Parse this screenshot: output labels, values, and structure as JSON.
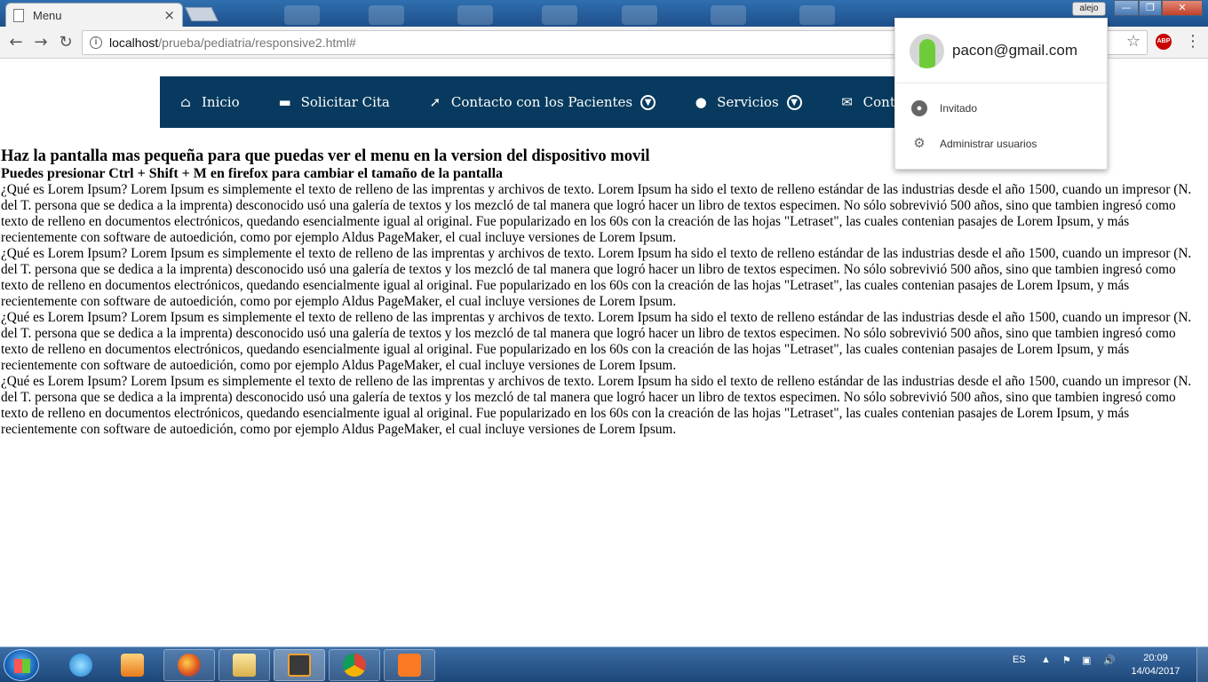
{
  "browser": {
    "tab_title": "Menu",
    "tab_close": "×",
    "user_badge": "alejo",
    "url_host": "localhost",
    "url_path": "/prueba/pediatria/responsive2.html#",
    "controls": {
      "back_icon": "arrow-left-icon",
      "forward_icon": "arrow-right-icon",
      "reload_icon": "reload-icon"
    },
    "extension_label": "ABP"
  },
  "nav": {
    "items": [
      {
        "label": "Inicio",
        "icon": "home-icon"
      },
      {
        "label": "Solicitar Cita",
        "icon": "briefcase-icon"
      },
      {
        "label": "Contacto con los Pacientes",
        "icon": "rocket-icon",
        "dropdown": true
      },
      {
        "label": "Servicios",
        "icon": "globe-icon",
        "dropdown": true
      },
      {
        "label": "Contacto",
        "icon": "envelope-icon"
      }
    ],
    "color": "#073a5e"
  },
  "content": {
    "heading": "Haz la pantalla mas pequeña para que puedas ver el menu en la version del dispositivo movil",
    "subheading": "Puedes presionar Ctrl + Shift + M en firefox para cambiar el tamaño de la pantalla",
    "paragraphs": [
      "¿Qué es Lorem Ipsum? Lorem Ipsum es simplemente el texto de relleno de las imprentas y archivos de texto. Lorem Ipsum ha sido el texto de relleno estándar de las industrias desde el año 1500, cuando un impresor (N. del T. persona que se dedica a la imprenta) desconocido usó una galería de textos y los mezcló de tal manera que logró hacer un libro de textos especimen. No sólo sobrevivió 500 años, sino que tambien ingresó como texto de relleno en documentos electrónicos, quedando esencialmente igual al original. Fue popularizado en los 60s con la creación de las hojas \"Letraset\", las cuales contenian pasajes de Lorem Ipsum, y más recientemente con software de autoedición, como por ejemplo Aldus PageMaker, el cual incluye versiones de Lorem Ipsum.",
      "¿Qué es Lorem Ipsum? Lorem Ipsum es simplemente el texto de relleno de las imprentas y archivos de texto. Lorem Ipsum ha sido el texto de relleno estándar de las industrias desde el año 1500, cuando un impresor (N. del T. persona que se dedica a la imprenta) desconocido usó una galería de textos y los mezcló de tal manera que logró hacer un libro de textos especimen. No sólo sobrevivió 500 años, sino que tambien ingresó como texto de relleno en documentos electrónicos, quedando esencialmente igual al original. Fue popularizado en los 60s con la creación de las hojas \"Letraset\", las cuales contenian pasajes de Lorem Ipsum, y más recientemente con software de autoedición, como por ejemplo Aldus PageMaker, el cual incluye versiones de Lorem Ipsum.",
      "¿Qué es Lorem Ipsum? Lorem Ipsum es simplemente el texto de relleno de las imprentas y archivos de texto. Lorem Ipsum ha sido el texto de relleno estándar de las industrias desde el año 1500, cuando un impresor (N. del T. persona que se dedica a la imprenta) desconocido usó una galería de textos y los mezcló de tal manera que logró hacer un libro de textos especimen. No sólo sobrevivió 500 años, sino que tambien ingresó como texto de relleno en documentos electrónicos, quedando esencialmente igual al original. Fue popularizado en los 60s con la creación de las hojas \"Letraset\", las cuales contenian pasajes de Lorem Ipsum, y más recientemente con software de autoedición, como por ejemplo Aldus PageMaker, el cual incluye versiones de Lorem Ipsum.",
      "¿Qué es Lorem Ipsum? Lorem Ipsum es simplemente el texto de relleno de las imprentas y archivos de texto. Lorem Ipsum ha sido el texto de relleno estándar de las industrias desde el año 1500, cuando un impresor (N. del T. persona que se dedica a la imprenta) desconocido usó una galería de textos y los mezcló de tal manera que logró hacer un libro de textos especimen. No sólo sobrevivió 500 años, sino que tambien ingresó como texto de relleno en documentos electrónicos, quedando esencialmente igual al original. Fue popularizado en los 60s con la creación de las hojas \"Letraset\", las cuales contenian pasajes de Lorem Ipsum, y más recientemente con software de autoedición, como por ejemplo Aldus PageMaker, el cual incluye versiones de Lorem Ipsum."
    ]
  },
  "profile_menu": {
    "email": "pacon@gmail.com",
    "items": [
      {
        "label": "Invitado",
        "icon": "account-icon"
      },
      {
        "label": "Administrar usuarios",
        "icon": "gear-icon"
      }
    ]
  },
  "taskbar": {
    "apps": [
      "internet-explorer-icon",
      "media-player-icon",
      "firefox-icon",
      "file-explorer-icon",
      "sublime-text-icon",
      "chrome-icon",
      "xampp-icon"
    ],
    "language": "ES",
    "time": "20:09",
    "date": "14/04/2017"
  }
}
